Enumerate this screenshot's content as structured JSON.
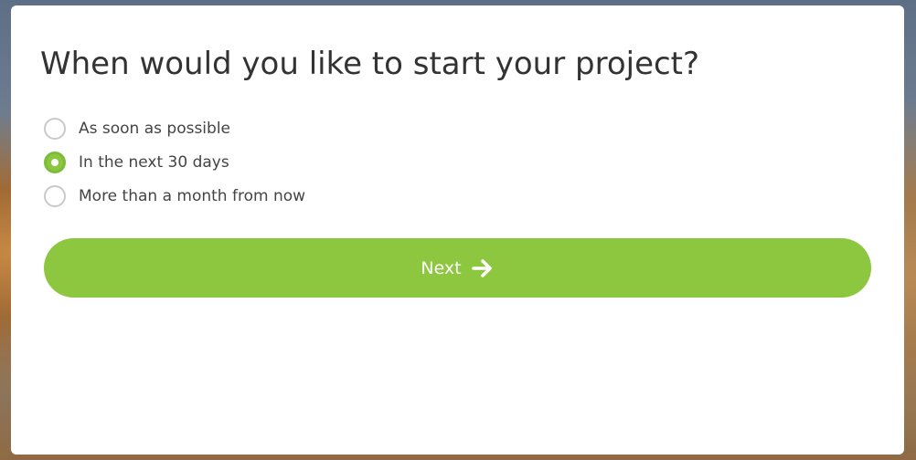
{
  "question": {
    "title": "When would you like to start your project?"
  },
  "options": [
    {
      "label": "As soon as possible",
      "selected": false
    },
    {
      "label": "In the next 30 days",
      "selected": true
    },
    {
      "label": "More than a month from now",
      "selected": false
    }
  ],
  "next_button": {
    "label": "Next",
    "icon": "arrow-right-icon"
  },
  "colors": {
    "accent": "#8dc63f",
    "text": "#333333",
    "radio_border": "#c9c9c9"
  }
}
